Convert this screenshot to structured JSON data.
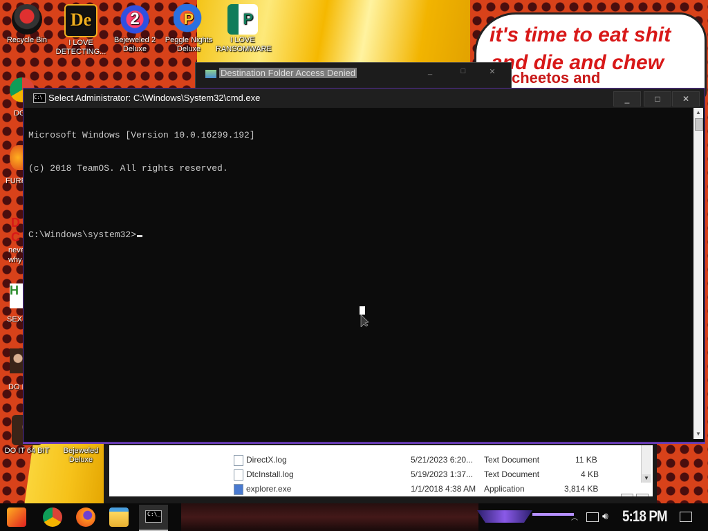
{
  "wallpaper": {
    "speech_line_1": "it's time to eat shit",
    "speech_line_2": "and die and chew",
    "speech_line_3": "cheetos and"
  },
  "desktop_icons": [
    {
      "label": "Recycle Bin",
      "icon": "recycle-bin-icon"
    },
    {
      "label": "I LOVE DETECTING...",
      "icon": "de-app-icon"
    },
    {
      "label": "Bejeweled 2 Deluxe",
      "icon": "bejeweled-icon"
    },
    {
      "label": "Peggle Nights Deluxe",
      "icon": "peggle-icon"
    },
    {
      "label": "I LOVE RANSOMWARE",
      "icon": "publisher-icon"
    },
    {
      "label": "DO IT 64 BIT",
      "icon": "portrait-icon"
    },
    {
      "label": "Bejeweled Deluxe",
      "icon": "bejeweled-icon"
    }
  ],
  "desktop_partial_labels": [
    "DO",
    "FURF",
    "neve",
    "why",
    "SEX",
    "DO I",
    "DO I"
  ],
  "dest_window": {
    "title": "Destination Folder Access Denied"
  },
  "cmd_window": {
    "title": "Select Administrator: C:\\Windows\\System32\\cmd.exe",
    "lines": [
      "Microsoft Windows [Version 10.0.16299.192]",
      "(c) 2018 TeamOS. All rights reserved.",
      "",
      "C:\\Windows\\system32>"
    ],
    "controls": {
      "minimize": "_",
      "maximize": "□",
      "close": "✕"
    }
  },
  "explorer": {
    "files": [
      {
        "name": "DirectX.log",
        "date": "5/21/2023 6:20...",
        "type": "Text Document",
        "size": "11 KB"
      },
      {
        "name": "DtcInstall.log",
        "date": "5/19/2023 1:37...",
        "type": "Text Document",
        "size": "4 KB"
      },
      {
        "name": "explorer.exe",
        "date": "1/1/2018 4:38 AM",
        "type": "Application",
        "size": "3,814 KB"
      }
    ]
  },
  "taskbar": {
    "clock": "5:18 PM",
    "pinned": [
      "start-icon",
      "chrome-icon",
      "firefox-icon",
      "file-explorer-icon",
      "cmd-icon"
    ]
  },
  "colors": {
    "cmd_bg": "#0c0c0c",
    "cmd_text": "#cccccc",
    "cmd_border": "#5a2fa0",
    "wallpaper_red": "#d8421a",
    "speech_red": "#d81818"
  }
}
